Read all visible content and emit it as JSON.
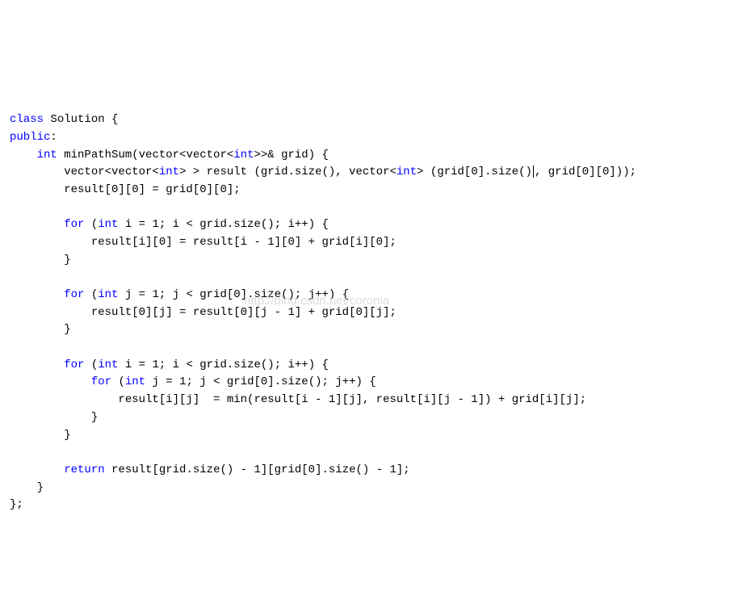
{
  "watermark": "http://blog.csdn.net/coronia",
  "code": {
    "l1_class": "class",
    "l1_sol": " Solution {",
    "l2_public": "public",
    "l2_colon": ":",
    "l3_indent": "    ",
    "l3_int": "int",
    "l3_fn": " minPathSum(vector<vector<",
    "l3_inttype": "int",
    "l3_rest": ">>& grid) {",
    "l4_indent": "        vector<vector<",
    "l4_int1": "int",
    "l4_mid": "> > result (grid.size(), vector<",
    "l4_int2": "int",
    "l4_tail1": "> (grid[",
    "l4_z1": "0",
    "l4_tail2": "].size()",
    "l4_tail3": ", grid[",
    "l4_z2": "0",
    "l4_tail4": "][",
    "l4_z3": "0",
    "l4_tail5": "]));",
    "l5": "        result[0][0] = grid[0][0];",
    "l6": "",
    "l7_indent": "        ",
    "l7_for": "for",
    "l7_open": " (",
    "l7_int": "int",
    "l7_rest": " i = 1; i < grid.size(); i++) {",
    "l8": "            result[i][0] = result[i - 1][0] + grid[i][0];",
    "l9": "        }",
    "l10": "",
    "l11_indent": "        ",
    "l11_for": "for",
    "l11_open": " (",
    "l11_int": "int",
    "l11_rest": " j = 1; j < grid[0].size(); j++) {",
    "l12": "            result[0][j] = result[0][j - 1] + grid[0][j];",
    "l13": "        }",
    "l14": "",
    "l15_indent": "        ",
    "l15_for": "for",
    "l15_open": " (",
    "l15_int": "int",
    "l15_rest": " i = 1; i < grid.size(); i++) {",
    "l16_indent": "            ",
    "l16_for": "for",
    "l16_open": " (",
    "l16_int": "int",
    "l16_rest": " j = 1; j < grid[0].size(); j++) {",
    "l17": "                result[i][j]  = min(result[i - 1][j], result[i][j - 1]) + grid[i][j];",
    "l18": "            }",
    "l19": "        }",
    "l20": "",
    "l21_indent": "        ",
    "l21_return": "return",
    "l21_rest": " result[grid.size() - 1][grid[0].size() - 1];",
    "l22": "    }",
    "l23": "};"
  }
}
